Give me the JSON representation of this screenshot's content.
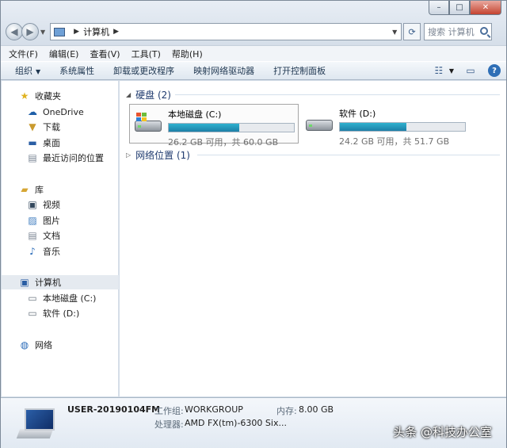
{
  "window": {
    "caption": {
      "minimize": "–",
      "maximize": "□",
      "close": "✕"
    }
  },
  "address": {
    "path": "计算机",
    "search_placeholder": "搜索 计算机"
  },
  "menu": [
    "文件(F)",
    "编辑(E)",
    "查看(V)",
    "工具(T)",
    "帮助(H)"
  ],
  "toolbar": {
    "organize": "组织",
    "items": [
      "系统属性",
      "卸载或更改程序",
      "映射网络驱动器",
      "打开控制面板"
    ]
  },
  "navpane": {
    "favorites": "收藏夹",
    "onedrive": "OneDrive",
    "downloads": "下载",
    "desktop": "桌面",
    "recent": "最近访问的位置",
    "libraries": "库",
    "videos": "视频",
    "pictures": "图片",
    "documents": "文档",
    "music": "音乐",
    "computer": "计算机",
    "local_disk": "本地磁盘 (C:)",
    "software": "软件 (D:)",
    "network": "网络"
  },
  "content": {
    "hard_drives_header": "硬盘 (2)",
    "network_header": "网络位置 (1)",
    "drives": [
      {
        "name": "本地磁盘 (C:)",
        "size": "26.2 GB 可用，共 60.0 GB",
        "used_fraction": 0.563
      },
      {
        "name": "软件 (D:)",
        "size": "24.2 GB 可用，共 51.7 GB",
        "used_fraction": 0.532
      }
    ]
  },
  "details": {
    "computer_name": "USER-20190104FM",
    "workgroup_label": "工作组:",
    "workgroup": "WORKGROUP",
    "memory_label": "内存:",
    "memory": "8.00 GB",
    "processor_label": "处理器:",
    "processor": "AMD FX(tm)-6300 Six..."
  },
  "watermark": "头条 @科技办公室"
}
